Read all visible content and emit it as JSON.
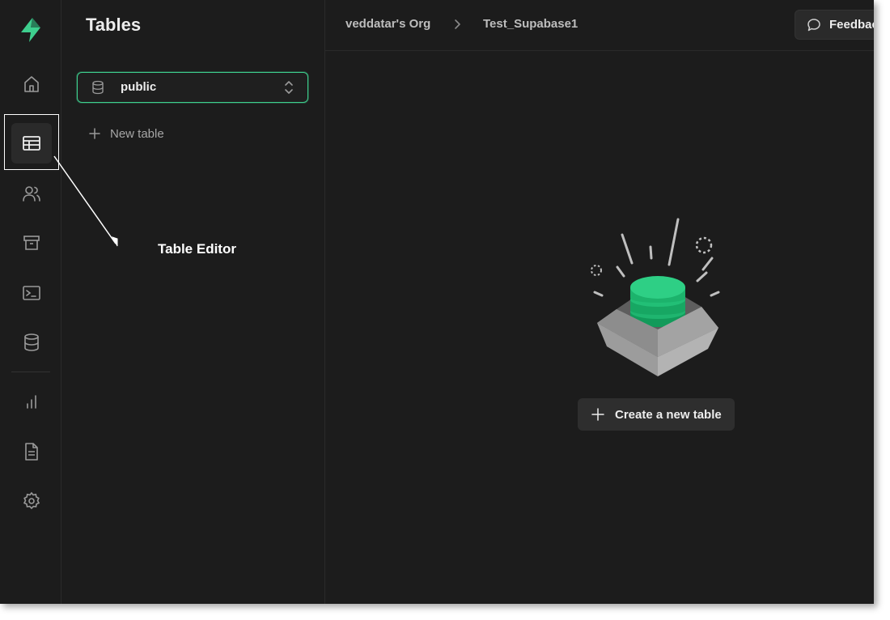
{
  "sidebar": {
    "title": "Tables",
    "schema_selector": {
      "value": "public"
    },
    "new_table_label": "New table"
  },
  "nav_rail": {
    "items": [
      {
        "name": "home",
        "icon": "home-icon",
        "active": false
      },
      {
        "name": "table-editor",
        "icon": "table-icon",
        "active": true
      },
      {
        "name": "authentication",
        "icon": "users-icon",
        "active": false
      },
      {
        "name": "storage",
        "icon": "archive-icon",
        "active": false
      },
      {
        "name": "sql-editor",
        "icon": "terminal-icon",
        "active": false
      },
      {
        "name": "database",
        "icon": "database-icon",
        "active": false
      },
      {
        "name": "reports",
        "icon": "bar-chart-icon",
        "active": false
      },
      {
        "name": "api-docs",
        "icon": "document-icon",
        "active": false
      },
      {
        "name": "settings",
        "icon": "gear-icon",
        "active": false
      }
    ]
  },
  "header": {
    "breadcrumb": [
      "veddatar's Org",
      "Test_Supabase1"
    ],
    "feedback_label": "Feedback"
  },
  "main": {
    "empty_state": {
      "create_button_label": "Create a new table"
    }
  },
  "annotation": {
    "label": "Table Editor"
  },
  "colors": {
    "brand_green": "#3ecf8e",
    "background": "#1c1c1c"
  }
}
